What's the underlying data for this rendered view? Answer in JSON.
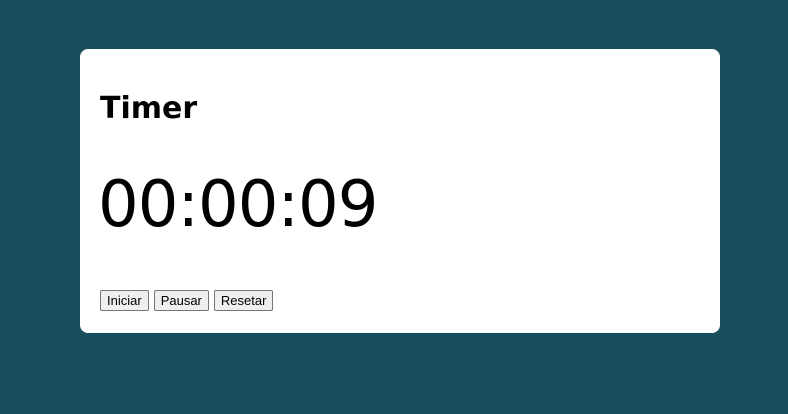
{
  "page": {
    "background_color": "#174e5c",
    "card_color": "#ffffff"
  },
  "timer": {
    "title": "Timer",
    "display": "00:00:09"
  },
  "controls": {
    "start_label": "Iniciar",
    "pause_label": "Pausar",
    "reset_label": "Resetar"
  }
}
